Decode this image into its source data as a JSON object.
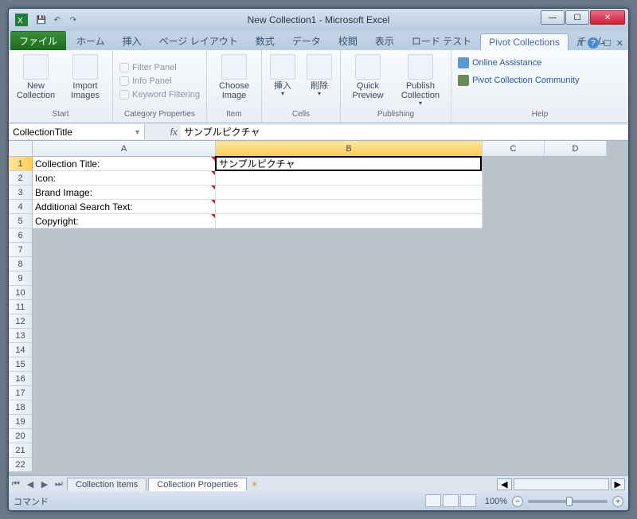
{
  "window": {
    "title": "New Collection1 - Microsoft Excel"
  },
  "tabs": {
    "file": "ファイル",
    "items": [
      "ホーム",
      "挿入",
      "ページ レイアウト",
      "数式",
      "データ",
      "校閲",
      "表示",
      "ロード テスト",
      "Pivot Collections",
      "チーム"
    ],
    "active": "Pivot Collections"
  },
  "ribbon": {
    "start": {
      "label": "Start",
      "new_collection": "New Collection",
      "import_images": "Import Images"
    },
    "catprops": {
      "label": "Category Properties",
      "filter": "Filter Panel",
      "info": "Info Panel",
      "keyword": "Keyword Filtering"
    },
    "item": {
      "label": "Item",
      "choose_image": "Choose Image"
    },
    "cells": {
      "label": "Cells",
      "insert": "挿入",
      "delete": "削除"
    },
    "publishing": {
      "label": "Publishing",
      "quick": "Quick Preview",
      "publish": "Publish Collection"
    },
    "help": {
      "label": "Help",
      "online": "Online Assistance",
      "community": "Pivot Collection Community"
    }
  },
  "namebox": "CollectionTitle",
  "formula": "サンプルピクチャ",
  "columns": [
    "A",
    "B",
    "C",
    "D"
  ],
  "rows": [
    {
      "n": 1,
      "a": "Collection Title:",
      "b": "サンプルピクチャ",
      "active": true
    },
    {
      "n": 2,
      "a": "Icon:",
      "b": ""
    },
    {
      "n": 3,
      "a": "Brand Image:",
      "b": ""
    },
    {
      "n": 4,
      "a": "Additional Search Text:",
      "b": ""
    },
    {
      "n": 5,
      "a": "Copyright:",
      "b": ""
    }
  ],
  "empty_rows": [
    6,
    7,
    8,
    9,
    10,
    11,
    12,
    13,
    14,
    15,
    16,
    17,
    18,
    19,
    20,
    21,
    22
  ],
  "sheets": {
    "items": "Collection Items",
    "props": "Collection Properties"
  },
  "status": {
    "mode": "コマンド",
    "zoom": "100%"
  },
  "colwidths": {
    "A": 230,
    "B": 335,
    "C": 78,
    "D": 78
  }
}
